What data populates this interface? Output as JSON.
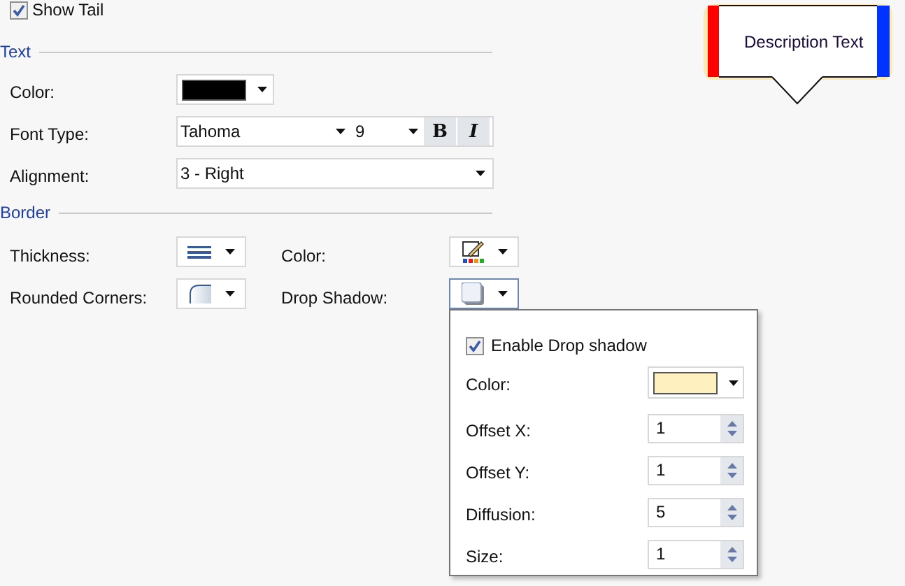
{
  "show_tail": {
    "label": "Show Tail",
    "checked": true
  },
  "preview": {
    "text": "Description Text"
  },
  "text_section": {
    "heading": "Text",
    "color": {
      "label": "Color:",
      "color": "#000000"
    },
    "font_type": {
      "label": "Font Type:",
      "font": "Tahoma",
      "size": "9",
      "bold_label": "B",
      "italic_label": "I"
    },
    "alignment": {
      "label": "Alignment:",
      "value": "3 - Right"
    }
  },
  "border_section": {
    "heading": "Border",
    "thickness": {
      "label": "Thickness:"
    },
    "color": {
      "label": "Color:"
    },
    "rounded_corners": {
      "label": "Rounded Corners:"
    },
    "drop_shadow": {
      "label": "Drop Shadow:",
      "expanded": true
    }
  },
  "drop_shadow_popup": {
    "enable": {
      "label": "Enable Drop shadow",
      "checked": true
    },
    "color": {
      "label": "Color:",
      "color": "#fff0c0"
    },
    "fields": [
      {
        "label": "Offset X:",
        "value": "1"
      },
      {
        "label": "Offset Y:",
        "value": "1"
      },
      {
        "label": "Diffusion:",
        "value": "5"
      },
      {
        "label": "Size:",
        "value": "1"
      }
    ]
  }
}
